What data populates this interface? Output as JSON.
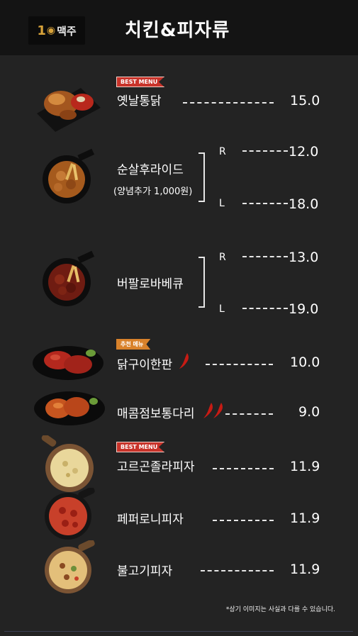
{
  "header": {
    "logo_number": "1",
    "logo_text": "맥주",
    "title": "치킨&피자류"
  },
  "menu": [
    {
      "name": "옛날통닭",
      "badge": "BEST MENU",
      "price": "15.0"
    },
    {
      "name": "순살후라이드",
      "sub": "(양념추가 1,000원)",
      "r_label": "R",
      "r_price": "12.0",
      "l_label": "L",
      "l_price": "18.0"
    },
    {
      "name": "버팔로바베큐",
      "r_label": "R",
      "r_price": "13.0",
      "l_label": "L",
      "l_price": "19.0"
    },
    {
      "name": "닭구이한판",
      "badge": "추천 메뉴",
      "price": "10.0"
    },
    {
      "name": "매콤점보통다리",
      "price": "9.0"
    },
    {
      "name": "고르곤졸라피자",
      "badge": "BEST MENU",
      "price": "11.9"
    },
    {
      "name": "페퍼로니피자",
      "price": "11.9"
    },
    {
      "name": "불고기피자",
      "price": "11.9"
    }
  ],
  "note": "*상기 이미지는 사실과 다를 수 있습니다.",
  "colors": {
    "badge_red": "#c8332a",
    "badge_orange": "#d9822b",
    "background": "#232323",
    "header": "#141414"
  }
}
